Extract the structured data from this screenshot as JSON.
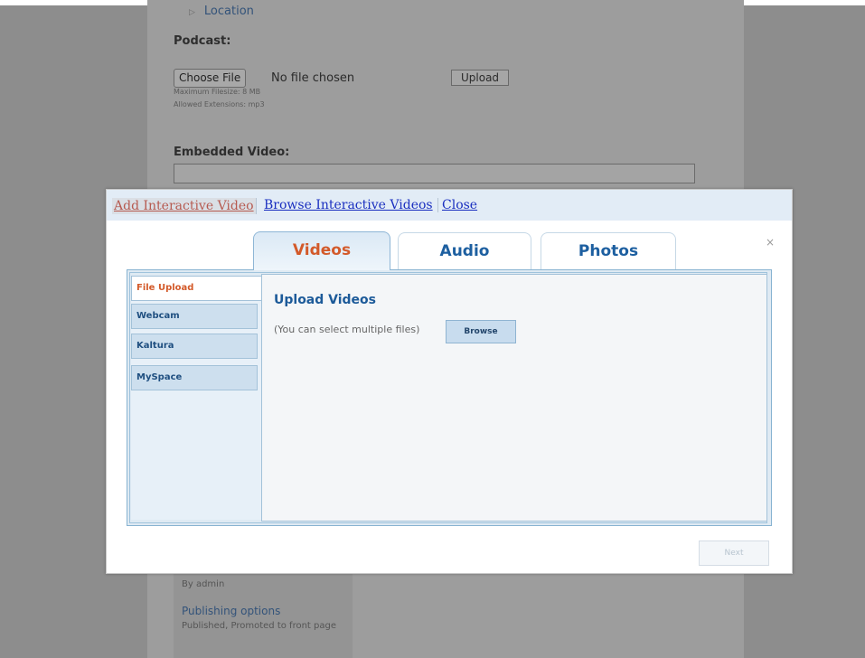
{
  "background": {
    "location_link": "Location",
    "podcast_label": "Podcast:",
    "choose_file_label": "Choose File",
    "no_file_text": "No file chosen",
    "upload_button_label": "Upload",
    "max_filesize": "Maximum Filesize: 8 MB",
    "allowed_extensions": "Allowed Extensions: mp3",
    "embedded_video_label": "Embedded Video:",
    "by_admin": "By admin",
    "publishing_title": "Publishing options",
    "publishing_sub": "Published, Promoted to front page"
  },
  "modal": {
    "links": {
      "add": "Add Interactive Video",
      "browse": "Browse Interactive Videos",
      "close": "Close"
    },
    "x_close": "×",
    "tabs": [
      "Videos",
      "Audio",
      "Photos"
    ],
    "active_tab": "Videos",
    "side_tabs": [
      "File Upload",
      "Webcam",
      "Kaltura",
      "MySpace"
    ],
    "active_side_tab": "File Upload",
    "upload": {
      "title": "Upload Videos",
      "hint": "(You can select multiple files)",
      "browse_label": "Browse"
    },
    "next_label": "Next"
  },
  "colors": {
    "accent_active": "#d35a2a",
    "tab_text": "#1d5fa0",
    "link_blue": "#1a2fc0"
  }
}
